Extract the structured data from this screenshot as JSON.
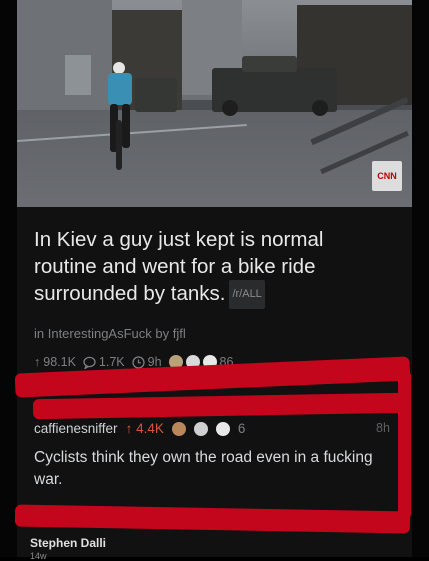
{
  "post": {
    "title": "In Kiev a guy just kept is normal routine and went for a bike ride surrounded by tanks.",
    "flair": "/r/ALL",
    "subreddit_line": "in InterestingAsFuck  by fjfl",
    "upvotes": "98.1K",
    "comments": "1.7K",
    "age": "9h",
    "award_count": "86",
    "thumbnail_badge": "CNN"
  },
  "comment": {
    "username": "caffienesniffer",
    "score": "4.4K",
    "award_count": "6",
    "age": "8h",
    "text": "Cyclists think they own the road even in a fucking war."
  },
  "next": {
    "username": "Stephen Dalli",
    "meta": "14w"
  },
  "colors": {
    "background": "#111112",
    "highlight": "#c4061c",
    "upvote": "#d4573c"
  }
}
